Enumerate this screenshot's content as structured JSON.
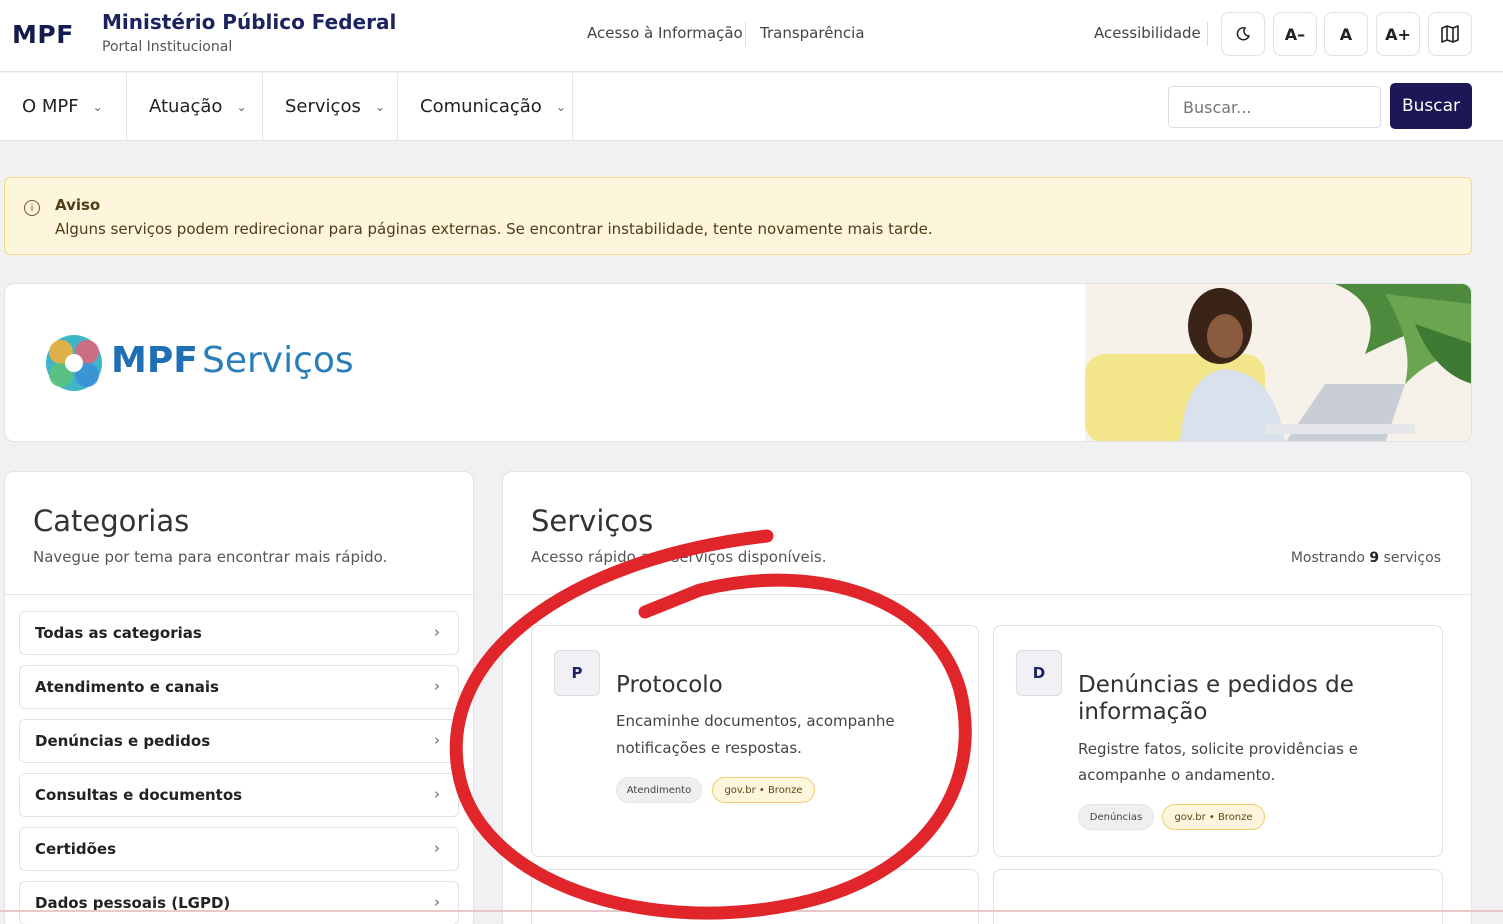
{
  "header": {
    "logo": "MPF",
    "org_name": "Ministério Público Federal",
    "org_sub": "Portal Institucional",
    "links": [
      "Acesso à Informação",
      "Transparência"
    ],
    "accessibility_label": "Acessibilidade",
    "font_buttons": [
      "A–",
      "A",
      "A+"
    ],
    "icons": [
      "moon-icon",
      "map-icon"
    ]
  },
  "nav": {
    "items": [
      {
        "label": "O MPF"
      },
      {
        "label": "Atuação"
      },
      {
        "label": "Serviços"
      },
      {
        "label": "Comunicação"
      }
    ],
    "search_placeholder": "Buscar...",
    "search_button": "Buscar"
  },
  "alert": {
    "title": "Aviso",
    "text": "Alguns serviços podem redirecionar para páginas externas. Se encontrar instabilidade, tente novamente mais tarde."
  },
  "banner": {
    "brand_bold": "MPF",
    "brand_light": "Serviços"
  },
  "categories": {
    "title": "Categorias",
    "subtitle": "Navegue por tema para encontrar mais rápido.",
    "items": [
      {
        "label": "Todas as categorias"
      },
      {
        "label": "Atendimento e canais"
      },
      {
        "label": "Denúncias e pedidos"
      },
      {
        "label": "Consultas e documentos"
      },
      {
        "label": "Certidões"
      },
      {
        "label": "Dados pessoais (LGPD)"
      }
    ]
  },
  "services": {
    "title": "Serviços",
    "subtitle": "Acesso rápido aos serviços disponíveis.",
    "count_prefix": "Mostrando",
    "count_value": "9",
    "count_suffix": "serviços",
    "cards": [
      {
        "letter": "P",
        "title": "Protocolo",
        "desc_line1": "Encaminhe documentos, acompanhe",
        "desc_line2": "notificações e respostas.",
        "tag_category": "Atendimento",
        "tag_level": "gov.br • Bronze"
      },
      {
        "letter": "D",
        "title_line1": "Denúncias e pedidos de",
        "title_line2": "informação",
        "desc_line1": "Registre fatos, solicite providências e",
        "desc_line2": "acompanhe o andamento.",
        "tag_category": "Denúncias",
        "tag_level": "gov.br • Bronze"
      }
    ]
  },
  "colors": {
    "brand_navy": "#1c1857",
    "annotation_red": "#e0262b",
    "alert_bg": "#fdf5dc"
  }
}
